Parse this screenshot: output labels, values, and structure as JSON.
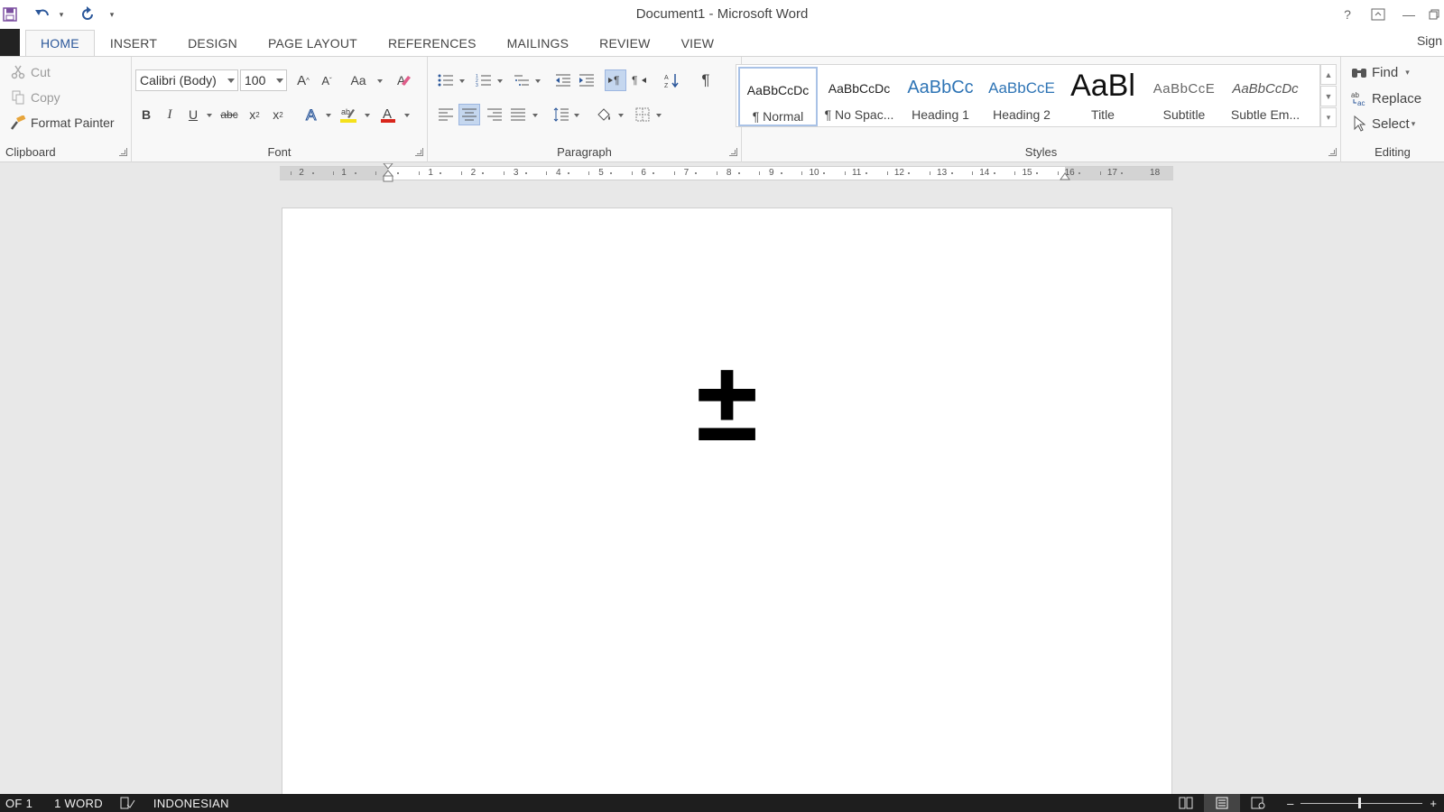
{
  "window": {
    "title": "Document1 - Microsoft Word",
    "sign_in": "Sign"
  },
  "quick_access": {
    "icons": [
      "save-icon",
      "undo-icon",
      "redo-icon",
      "customize-icon"
    ]
  },
  "tabs": [
    {
      "label": "HOME",
      "active": true
    },
    {
      "label": "INSERT"
    },
    {
      "label": "DESIGN"
    },
    {
      "label": "PAGE LAYOUT"
    },
    {
      "label": "REFERENCES"
    },
    {
      "label": "MAILINGS"
    },
    {
      "label": "REVIEW"
    },
    {
      "label": "VIEW"
    }
  ],
  "clipboard": {
    "label": "Clipboard",
    "cut": "Cut",
    "copy": "Copy",
    "format_painter": "Format Painter"
  },
  "font": {
    "label": "Font",
    "font_name": "Calibri (Body)",
    "font_size": "100",
    "change_case": "Aa",
    "text_color": "#d9261c",
    "highlight_color": "#f5e11b"
  },
  "paragraph": {
    "label": "Paragraph"
  },
  "styles": {
    "label": "Styles",
    "items": [
      {
        "sample": "AaBbCcDc",
        "name": "¶ Normal",
        "selected": true
      },
      {
        "sample": "AaBbCcDc",
        "name": "¶ No Spac..."
      },
      {
        "sample": "AaBbCc",
        "name": "Heading 1"
      },
      {
        "sample": "AaBbCcE",
        "name": "Heading 2"
      },
      {
        "sample": "AaBl",
        "name": "Title"
      },
      {
        "sample": "AaBbCcE",
        "name": "Subtitle"
      },
      {
        "sample": "AaBbCcDc",
        "name": "Subtle Em..."
      }
    ]
  },
  "editing": {
    "label": "Editing",
    "find": "Find",
    "replace": "Replace",
    "select": "Select"
  },
  "ruler": {
    "left_numbers": [
      "2",
      "1"
    ],
    "numbers": [
      "1",
      "2",
      "3",
      "4",
      "5",
      "6",
      "7",
      "8",
      "9",
      "10",
      "11",
      "12",
      "13",
      "14",
      "15",
      "16",
      "17",
      "18"
    ]
  },
  "document": {
    "content": "±"
  },
  "status": {
    "page": "OF 1",
    "words": "1 WORD",
    "language": "INDONESIAN"
  },
  "colors": {
    "accent": "#2b579a",
    "status_bar": "#1e1e1e"
  }
}
